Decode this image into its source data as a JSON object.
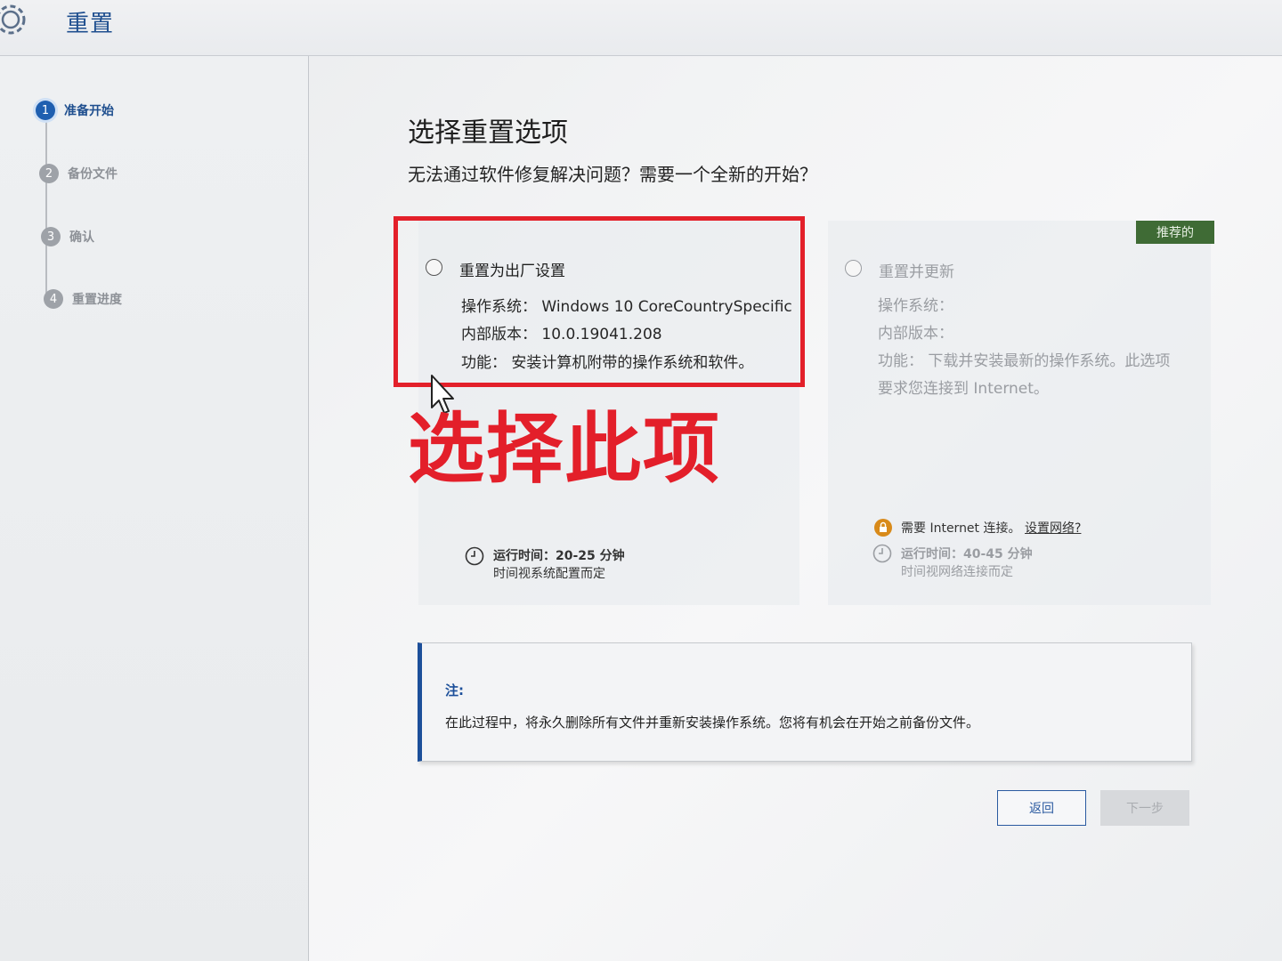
{
  "app": {
    "title": "重置"
  },
  "steps": [
    {
      "num": "1",
      "label": "准备开始"
    },
    {
      "num": "2",
      "label": "备份文件"
    },
    {
      "num": "3",
      "label": "确认"
    },
    {
      "num": "4",
      "label": "重置进度"
    }
  ],
  "main": {
    "title": "选择重置选项",
    "subtitle": "无法通过软件修复解决问题？需要一个全新的开始？"
  },
  "option_factory": {
    "title": "重置为出厂设置",
    "os": "操作系统：  Windows 10 CoreCountrySpecific",
    "build": "内部版本：  10.0.19041.208",
    "feature": "功能：  安装计算机附带的操作系统和软件。",
    "time": "运行时间：20-25 分钟",
    "time_note": "时间视系统配置而定"
  },
  "option_update": {
    "badge": "推荐的",
    "title": "重置并更新",
    "os": "操作系统：",
    "build": "内部版本：",
    "feature": "功能：  下载并安装最新的操作系统。此选项",
    "feature2": "要求您连接到 Internet。",
    "internet": "需要 Internet 连接。",
    "internet_link": "设置网络?",
    "time": "运行时间：40-45 分钟",
    "time_note": "时间视网络连接而定"
  },
  "annotation": {
    "text": "选择此项",
    "color": "#e3202a"
  },
  "note": {
    "title": "注:",
    "text": "在此过程中，将永久删除所有文件并重新安装操作系统。您将有机会在开始之前备份文件。"
  },
  "buttons": {
    "back": "返回",
    "next": "下一步"
  },
  "colors": {
    "accent": "#1f4f8f",
    "badge": "#3f6b35",
    "highlight": "#e3202a"
  },
  "icons": [
    "gear-icon",
    "clock-icon",
    "lock-icon",
    "cursor-icon"
  ]
}
